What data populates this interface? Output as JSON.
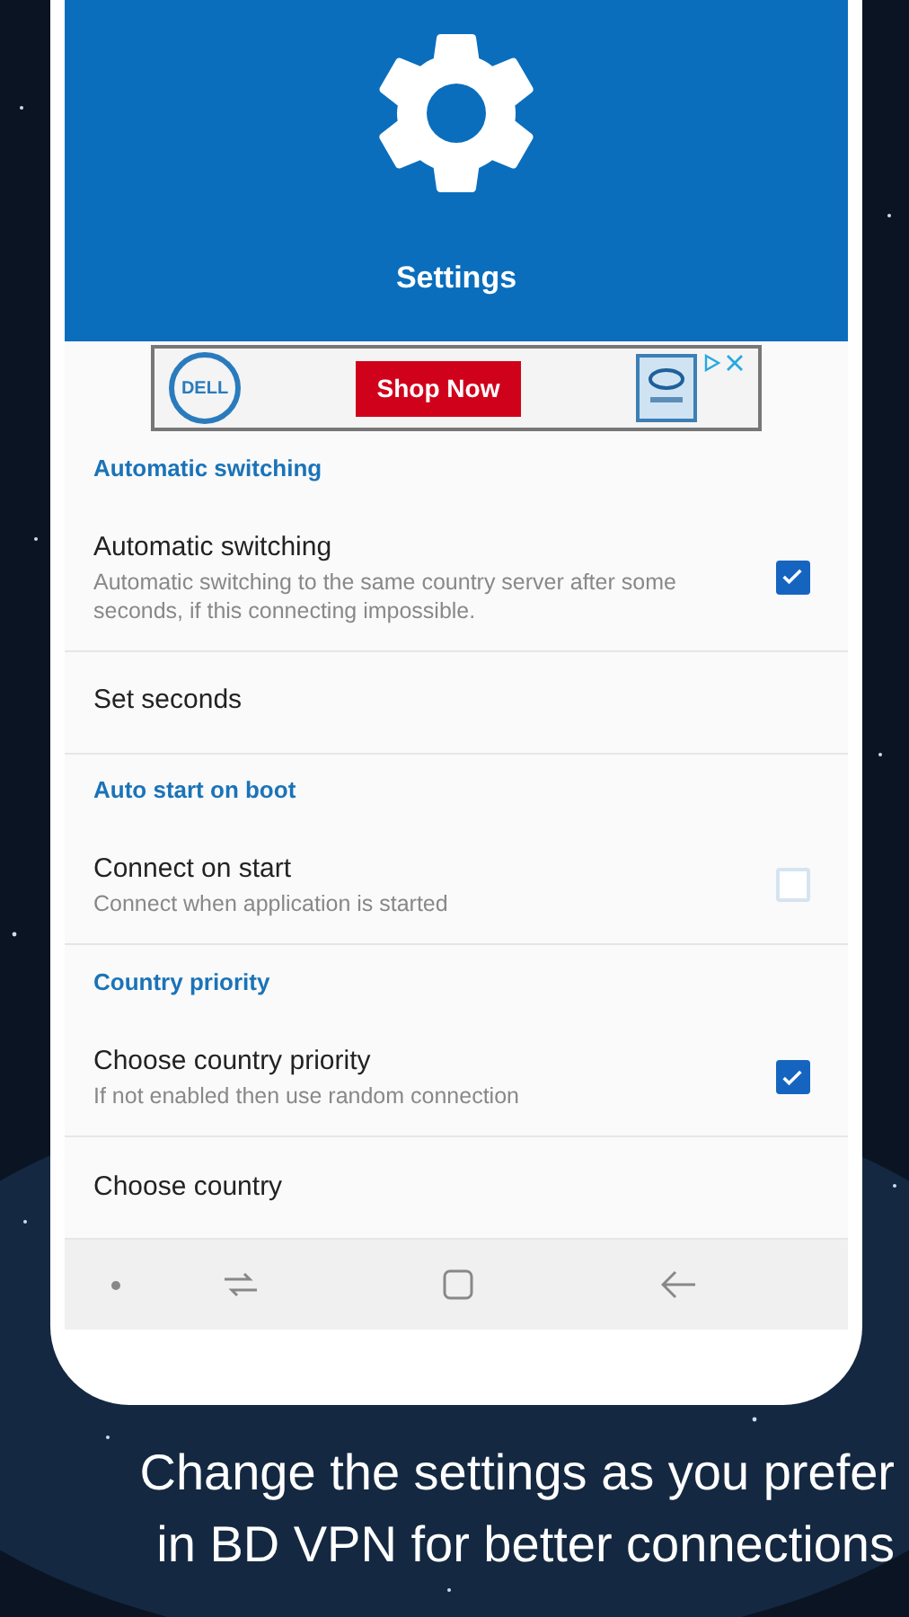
{
  "header": {
    "title": "Settings"
  },
  "ad": {
    "logo": "DELL",
    "button": "Shop Now"
  },
  "items": [
    {
      "kind": "header",
      "title": "Automatic switching"
    },
    {
      "kind": "checkbox",
      "title": "Automatic switching",
      "summary": "Automatic switching to the same country server after some seconds, if this connecting impossible.",
      "checked": true
    },
    {
      "kind": "plain",
      "title": "Set seconds"
    },
    {
      "kind": "header",
      "title": "Auto start on boot"
    },
    {
      "kind": "checkbox",
      "title": "Connect on start",
      "summary": "Connect when application is started",
      "checked": false
    },
    {
      "kind": "header",
      "title": "Country priority"
    },
    {
      "kind": "checkbox",
      "title": "Choose country priority",
      "summary": "If not enabled then use random connection",
      "checked": true
    },
    {
      "kind": "plain",
      "title": "Choose country"
    }
  ],
  "caption": [
    "Change the settings as you prefer",
    "in BD VPN for better connections"
  ]
}
